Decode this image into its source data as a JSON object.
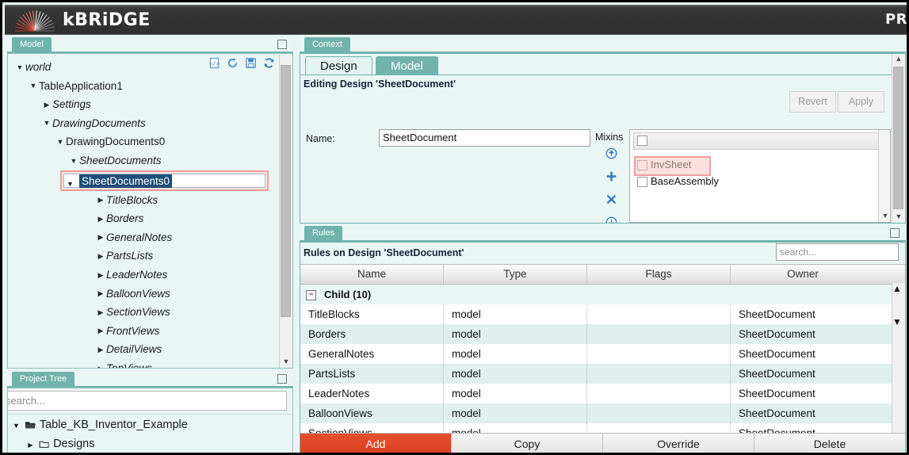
{
  "header": {
    "logo_text": "kBRiDGE",
    "logo_icon": "bridge-arc-logo",
    "right_text": "PR"
  },
  "model_panel": {
    "tab_label": "Model",
    "maximize_icon": "maximize-icon",
    "toolbar": [
      {
        "name": "code-document-icon",
        "title": "Source"
      },
      {
        "name": "history-icon",
        "title": "History"
      },
      {
        "name": "save-icon",
        "title": "Save"
      },
      {
        "name": "refresh-icon",
        "title": "Refresh"
      }
    ],
    "tree": [
      {
        "label": "world",
        "depth": 0,
        "twisty": "down",
        "italic": true
      },
      {
        "label": "TableApplication1",
        "depth": 1,
        "twisty": "down",
        "italic": false
      },
      {
        "label": "Settings",
        "depth": 2,
        "twisty": "right",
        "italic": true
      },
      {
        "label": "DrawingDocuments",
        "depth": 2,
        "twisty": "down",
        "italic": true
      },
      {
        "label": "DrawingDocuments0",
        "depth": 3,
        "twisty": "down",
        "italic": false
      },
      {
        "label": "SheetDocuments",
        "depth": 4,
        "twisty": "down",
        "italic": true
      },
      {
        "label": "SheetDocuments0",
        "depth": 5,
        "twisty": "down",
        "italic": false,
        "selected": true
      },
      {
        "label": "TitleBlocks",
        "depth": 6,
        "twisty": "right",
        "italic": true
      },
      {
        "label": "Borders",
        "depth": 6,
        "twisty": "right",
        "italic": true
      },
      {
        "label": "GeneralNotes",
        "depth": 6,
        "twisty": "right",
        "italic": true
      },
      {
        "label": "PartsLists",
        "depth": 6,
        "twisty": "right",
        "italic": true
      },
      {
        "label": "LeaderNotes",
        "depth": 6,
        "twisty": "right",
        "italic": true
      },
      {
        "label": "BalloonViews",
        "depth": 6,
        "twisty": "right",
        "italic": true
      },
      {
        "label": "SectionViews",
        "depth": 6,
        "twisty": "right",
        "italic": true
      },
      {
        "label": "FrontViews",
        "depth": 6,
        "twisty": "right",
        "italic": true
      },
      {
        "label": "DetailViews",
        "depth": 6,
        "twisty": "right",
        "italic": true
      },
      {
        "label": "TopViews",
        "depth": 6,
        "twisty": "right",
        "italic": true
      }
    ]
  },
  "project_panel": {
    "tab_label": "Project Tree",
    "maximize_icon": "maximize-icon",
    "search_placeholder": "search...",
    "items": [
      {
        "label": "Table_KB_Inventor_Example",
        "icon": "open-folder-icon",
        "twisty": "down"
      },
      {
        "label": "Designs",
        "icon": "folder-icon",
        "twisty": "right"
      }
    ]
  },
  "context_panel": {
    "tab_label": "Context",
    "maximize_icon": "maximize-icon",
    "tabs": [
      {
        "label": "Design",
        "active": true
      },
      {
        "label": "Model",
        "active": false
      }
    ],
    "editing_line": "Editing Design 'SheetDocument'",
    "buttons": [
      {
        "label": "Revert",
        "enabled": false
      },
      {
        "label": "Apply",
        "enabled": false
      }
    ],
    "name_label": "Name:",
    "name_value": "SheetDocument",
    "mixins_label": "Mixins",
    "mixin_actions": [
      {
        "name": "move-up-circle-icon"
      },
      {
        "name": "add-plus-icon"
      },
      {
        "name": "remove-x-icon"
      },
      {
        "name": "move-down-circle-icon"
      }
    ],
    "mixins": [
      {
        "label": "InvSheet",
        "checked": false,
        "highlighted": true
      },
      {
        "label": "BaseAssembly",
        "checked": false,
        "highlighted": false
      }
    ]
  },
  "rules_panel": {
    "tab_label": "Rules",
    "maximize_icon": "maximize-icon",
    "title": "Rules on Design 'SheetDocument'",
    "search_placeholder": "search...",
    "columns": [
      "Name",
      "Type",
      "Flags",
      "Owner"
    ],
    "group": {
      "label": "Child (10)",
      "expanded": true
    },
    "rows": [
      {
        "name": "TitleBlocks",
        "type": "model",
        "flags": "",
        "owner": "SheetDocument"
      },
      {
        "name": "Borders",
        "type": "model",
        "flags": "",
        "owner": "SheetDocument"
      },
      {
        "name": "GeneralNotes",
        "type": "model",
        "flags": "",
        "owner": "SheetDocument"
      },
      {
        "name": "PartsLists",
        "type": "model",
        "flags": "",
        "owner": "SheetDocument"
      },
      {
        "name": "LeaderNotes",
        "type": "model",
        "flags": "",
        "owner": "SheetDocument"
      },
      {
        "name": "BalloonViews",
        "type": "model",
        "flags": "",
        "owner": "SheetDocument"
      },
      {
        "name": "SectionViews",
        "type": "model",
        "flags": "",
        "owner": "SheetDocument"
      }
    ],
    "footer_buttons": [
      {
        "label": "Add",
        "primary": true
      },
      {
        "label": "Copy",
        "primary": false
      },
      {
        "label": "Override",
        "primary": false
      },
      {
        "label": "Delete",
        "primary": false
      }
    ]
  },
  "colors": {
    "teal": "#6fb3ab",
    "panel_bg": "#eaf6f4",
    "header_bg": "#333333",
    "highlight_pink": "#ef9e9a",
    "selection_blue": "#1f4e79",
    "accent_orange": "#e0533a",
    "add_button_red": "#e8502f"
  }
}
